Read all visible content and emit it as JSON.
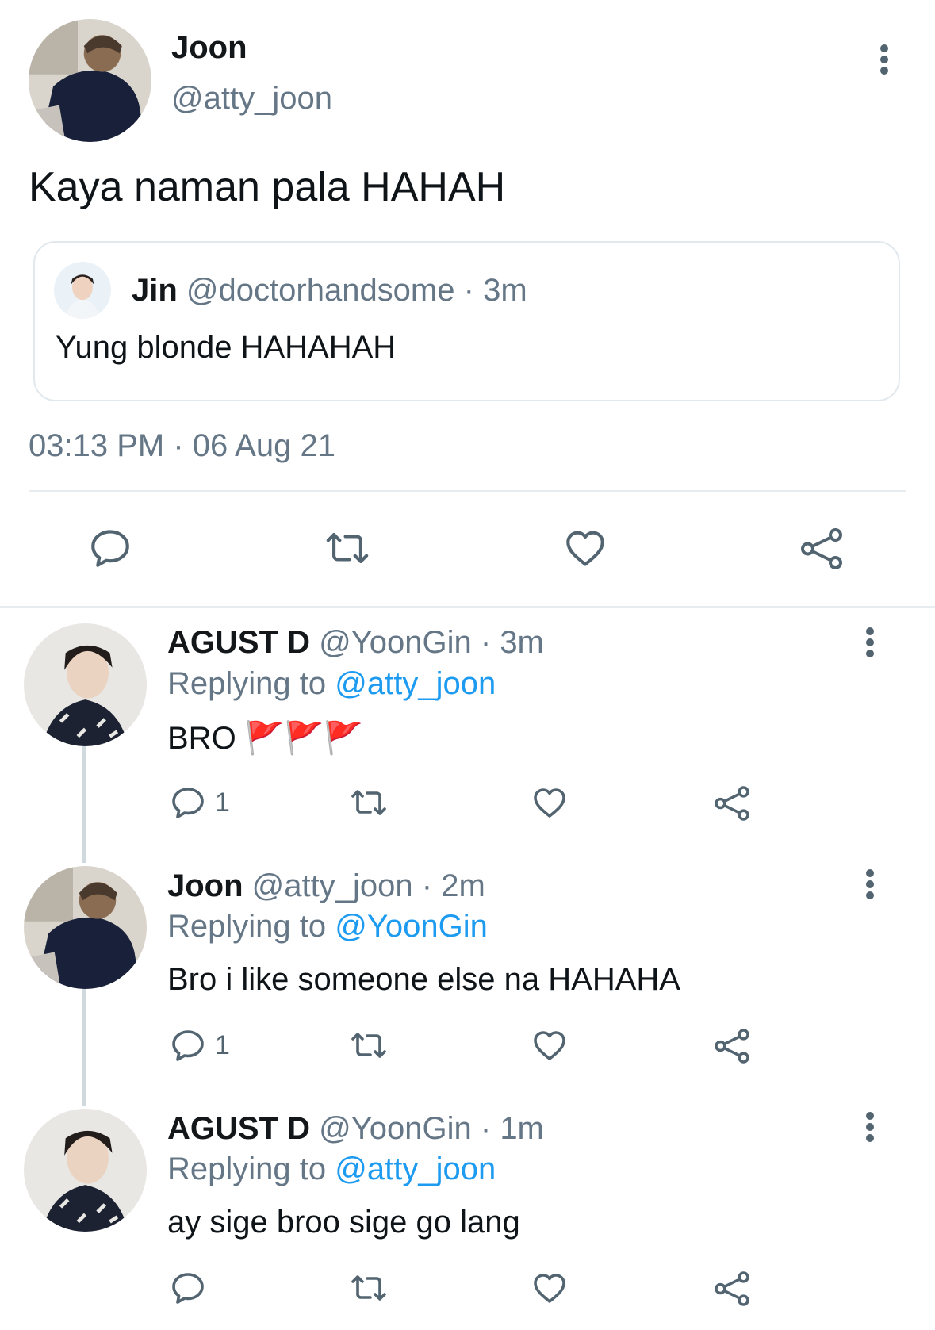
{
  "main_tweet": {
    "author_name": "Joon",
    "author_handle": "@atty_joon",
    "text": "Kaya naman pala HAHAH",
    "quote": {
      "author_name": "Jin",
      "author_handle": "@doctorhandsome",
      "separator": "·",
      "time": "3m",
      "text": "Yung blonde HAHAHAH"
    },
    "timestamp": "03:13 PM · 06 Aug 21",
    "actions": [
      "reply-icon",
      "retweet-icon",
      "like-icon",
      "share-icon"
    ]
  },
  "replies": [
    {
      "author_name": "AGUST D",
      "author_handle": "@YoonGin",
      "separator": "·",
      "time": "3m",
      "replying_prefix": "Replying to",
      "replying_to": "@atty_joon",
      "text": "BRO 🚩🚩🚩",
      "reply_count": "1"
    },
    {
      "author_name": "Joon",
      "author_handle": "@atty_joon",
      "separator": "·",
      "time": "2m",
      "replying_prefix": "Replying to",
      "replying_to": "@YoonGin",
      "text": "Bro i like someone else na HAHAHA",
      "reply_count": "1"
    },
    {
      "author_name": "AGUST D",
      "author_handle": "@YoonGin",
      "separator": "·",
      "time": "1m",
      "replying_prefix": "Replying to",
      "replying_to": "@atty_joon",
      "text": "ay sige broo sige go lang",
      "reply_count": ""
    }
  ],
  "colors": {
    "accent": "#1d9bf0",
    "muted": "#657786",
    "icon": "#536471",
    "border": "#e1e8ed",
    "flag_red": "#e8413a"
  }
}
